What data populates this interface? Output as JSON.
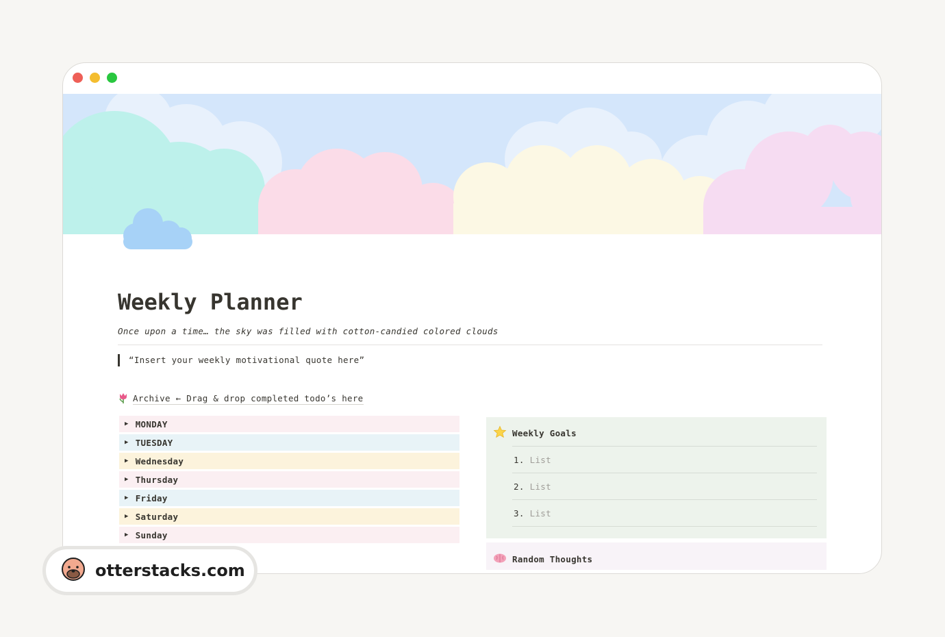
{
  "window": {
    "controls": [
      {
        "name": "close",
        "color": "#ee5f57"
      },
      {
        "name": "minimize",
        "color": "#f4bd2f"
      },
      {
        "name": "maximize",
        "color": "#29c73f"
      }
    ]
  },
  "cover": {
    "colors": {
      "sky": "#d4e6fb",
      "mint": "#bdf1eb",
      "pink": "#fbdce8",
      "yellow": "#fcf8e4",
      "lavender": "#f6dcf2"
    }
  },
  "page": {
    "icon": "cloud-icon",
    "icon_color": "#a7d2f7",
    "title": "Weekly Planner",
    "subtitle": "Once upon a time… the sky was filled with cotton-candied colored clouds",
    "quote": "“Insert your weekly motivational quote here”"
  },
  "archive": {
    "icon": "tulip-icon",
    "label": "Archive ← Drag & drop completed todo’s here"
  },
  "days": [
    {
      "label": "MONDAY",
      "color": "#fbeff2"
    },
    {
      "label": "TUESDAY",
      "color": "#e8f3f7"
    },
    {
      "label": "Wednesday",
      "color": "#fcf3dc"
    },
    {
      "label": "Thursday",
      "color": "#fbeff2"
    },
    {
      "label": "Friday",
      "color": "#e8f3f7"
    },
    {
      "label": "Saturday",
      "color": "#fcf3dc"
    },
    {
      "label": "Sunday",
      "color": "#fbeff2"
    }
  ],
  "goals": {
    "icon": "star-icon",
    "title": "Weekly Goals",
    "items": [
      {
        "num": "1.",
        "text": "List"
      },
      {
        "num": "2.",
        "text": "List"
      },
      {
        "num": "3.",
        "text": "List"
      }
    ]
  },
  "thoughts": {
    "icon": "brain-icon",
    "title": "Random Thoughts"
  },
  "badge": {
    "icon": "otter-icon",
    "text": "otterstacks.com"
  }
}
